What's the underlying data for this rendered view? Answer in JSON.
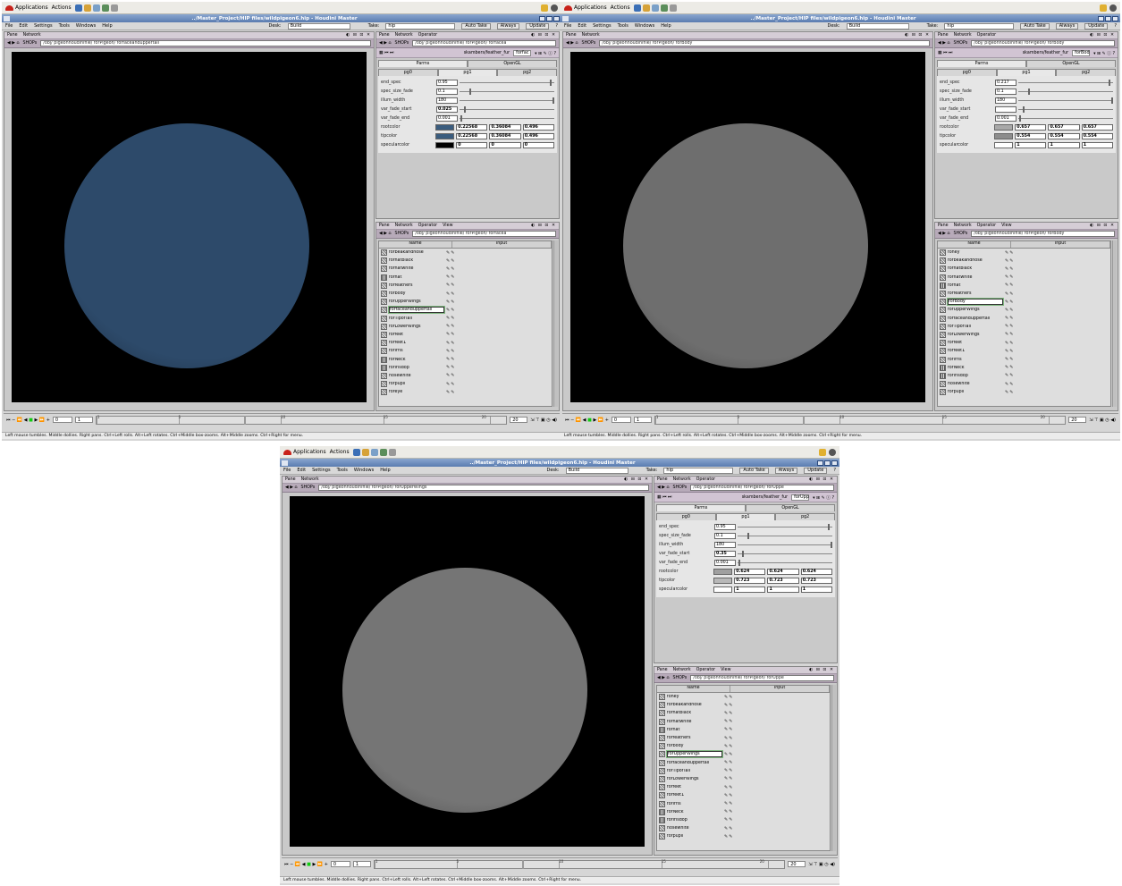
{
  "top": {
    "applications": "Applications",
    "actions": "Actions"
  },
  "window": {
    "title": "../Master_Project/HIP files/wildpigeon6.hip - Houdini Master"
  },
  "menu": [
    "File",
    "Edit",
    "Settings",
    "Tools",
    "Windows",
    "Help"
  ],
  "desk": {
    "label": "Desk:",
    "value": "Build"
  },
  "take": {
    "label": "Take:",
    "value": "hip",
    "auto_take": "Auto Take",
    "always": "Always",
    "update": "Update"
  },
  "pane": {
    "pane": "Pane",
    "network": "Network",
    "operator": "Operator",
    "view": "View",
    "shops": "SHOPs"
  },
  "tabs": {
    "parms": "Parms",
    "opengl": "OpenGL",
    "pg0": "pg0",
    "pg1": "pg1",
    "pg2": "pg2"
  },
  "list_hdr": {
    "name": "Name",
    "input": "Input"
  },
  "params": {
    "end_spec": "end_spec",
    "spec_size_fade": "spec_size_fade",
    "illum_width": "illum_width",
    "var_fade_start": "var_fade_start",
    "var_fade_end": "var_fade_end",
    "rootcolor": "rootcolor",
    "tipcolor": "tipcolor",
    "specularcolor": "specularcolor"
  },
  "timeline": {
    "frame": "0",
    "step": "1",
    "end": "20",
    "ticks": [
      "1",
      "5",
      "10",
      "15",
      "20"
    ]
  },
  "status": "Left mouse tumbles. Middle dollies. Right pans. Ctrl+Left rolls. Alt+Left rotates. Ctrl+Middle box-zooms. Alt+Middle zooms. Ctrl+Right for menu.",
  "shots": [
    {
      "viewport_path": "/obj/ pigeonhoudinifile/ forPigeon/ forfaceanduppertail",
      "param_path": "/obj/ pigeonhoudinifile/ forPigeon/ forfacea",
      "shader_type": "skambers/feather_fur",
      "shader_name": "forfac",
      "sphere_color": "#2d4a6a",
      "values": {
        "end_spec": "0.95",
        "spec_size_fade": "0.1",
        "illum_width": "180",
        "var_fade_start": "0.025",
        "var_fade_end": "0.001",
        "rootcolor": [
          "0.22568",
          "0.36084",
          "0.496"
        ],
        "tipcolor": [
          "0.22568",
          "0.36084",
          "0.496"
        ],
        "specularcolor": [
          "0",
          "0",
          "0"
        ],
        "root_swatch": "#3a5c7e",
        "tip_swatch": "#3a5c7e",
        "spec_swatch": "#000000"
      },
      "items": [
        "forbeakandnose",
        "forhatblack",
        "forhatwhite",
        "forhat",
        "forfeathers",
        "forbody",
        "forUpperWings",
        "forfaceanduppertail",
        "forTipofTail",
        "forLowerWings",
        "forfeet",
        "forfeet1",
        "forirris",
        "forNeck",
        "foririsdop",
        "nosewhite",
        "forpupil",
        "foreye"
      ],
      "selected": "forfaceanduppertail"
    },
    {
      "viewport_path": "/obj/ pigeonhoudinifile/ forPigeon/ forBody",
      "param_path": "/obj/ pigeonhoudinifile/ forPigeon/ forBody",
      "shader_type": "skambers/feather_fur",
      "shader_name": "forBod",
      "sphere_color": "#6e6e6e",
      "values": {
        "end_spec": "0.217",
        "spec_size_fade": "0.1",
        "illum_width": "180",
        "var_fade_start": "",
        "var_fade_end": "0.001",
        "rootcolor": [
          "0.657",
          "0.657",
          "0.657"
        ],
        "tipcolor": [
          "0.554",
          "0.554",
          "0.554"
        ],
        "specularcolor": [
          "1",
          "1",
          "1"
        ],
        "root_swatch": "#a8a8a8",
        "tip_swatch": "#8d8d8d",
        "spec_swatch": "#ffffff"
      },
      "items": [
        "foney",
        "forbeakandnose",
        "forhatblack",
        "forhatwhite",
        "forhat",
        "forfeathers",
        "forBody",
        "forUpperWings",
        "forfaceanduppertail",
        "forTipofTail",
        "forLowerWings",
        "forfeet",
        "forfeet1",
        "forirris",
        "forNeck",
        "foririsdop",
        "nosewhite",
        "forpupil"
      ],
      "selected": "forBody"
    },
    {
      "viewport_path": "/obj/ pigeonhoudinifile/ forPigeon/ forUpperWings",
      "param_path": "/obj/ pigeonhoudinifile/ forPigeon/ forUppe",
      "shader_type": "skambers/feather_fur",
      "shader_name": "forUpp",
      "sphere_color": "#757575",
      "values": {
        "end_spec": "0.95",
        "spec_size_fade": "0.1",
        "illum_width": "180",
        "var_fade_start": "0.35",
        "var_fade_end": "0.001",
        "rootcolor": [
          "0.624",
          "0.624",
          "0.624"
        ],
        "tipcolor": [
          "0.723",
          "0.723",
          "0.723"
        ],
        "specularcolor": [
          "1",
          "1",
          "1"
        ],
        "root_swatch": "#9f9f9f",
        "tip_swatch": "#b8b8b8",
        "spec_swatch": "#ffffff"
      },
      "items": [
        "foney",
        "forbeakandnose",
        "forhatblack",
        "forhatwhite",
        "forhat",
        "forfeathers",
        "forbody",
        "forUpperWings",
        "forfaceanduppertail",
        "forTipofTail",
        "forLowerWings",
        "forfeet",
        "forfeet1",
        "forirris",
        "forNeck",
        "foririsdop",
        "nosewhite",
        "forpupil"
      ],
      "selected": "forUpperWings"
    }
  ]
}
